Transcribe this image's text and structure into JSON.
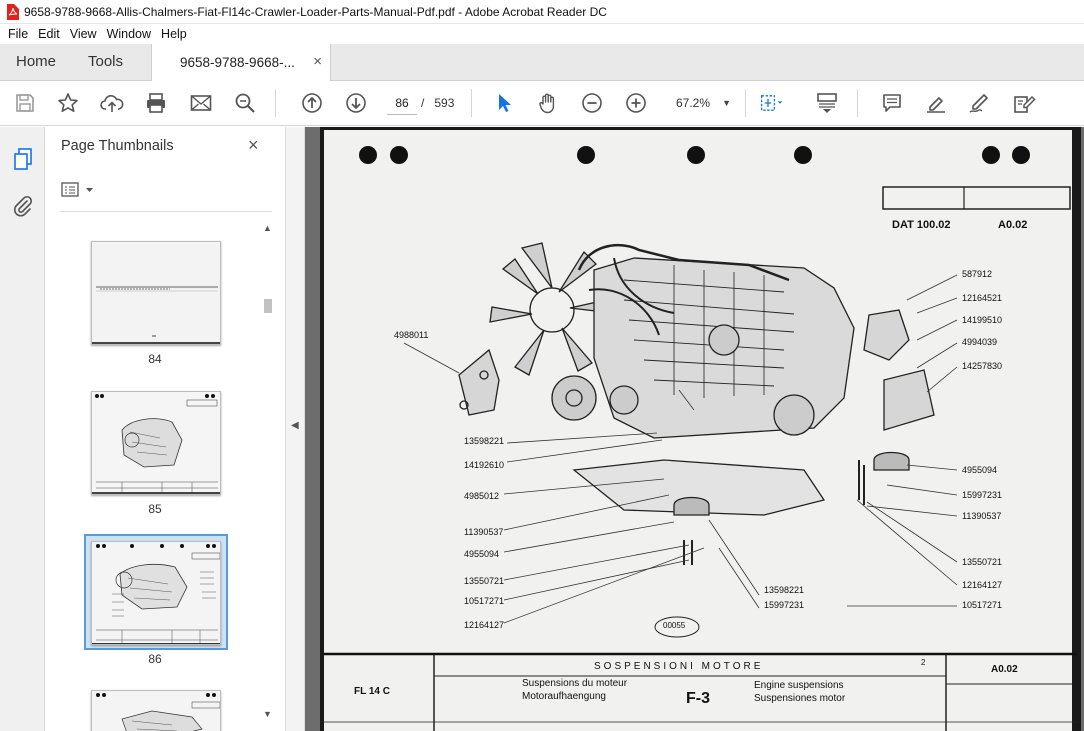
{
  "window": {
    "title": "9658-9788-9668-Allis-Chalmers-Fiat-Fl14c-Crawler-Loader-Parts-Manual-Pdf.pdf - Adobe Acrobat Reader DC"
  },
  "menu": [
    "File",
    "Edit",
    "View",
    "Window",
    "Help"
  ],
  "tabs": {
    "home": "Home",
    "tools": "Tools",
    "document": "9658-9788-9668-...",
    "close_symbol": "×"
  },
  "toolbar": {
    "current_page": "86",
    "page_separator": "/",
    "total_pages": "593",
    "zoom": "67.2%"
  },
  "thumbnails_panel": {
    "title": "Page Thumbnails",
    "close_symbol": "×",
    "pages": [
      {
        "label": "84"
      },
      {
        "label": "85"
      },
      {
        "label": "86",
        "selected": true
      }
    ]
  },
  "document_page": {
    "header_code_left": "DAT 100.02",
    "header_code_right": "A0.02",
    "part_numbers_left": [
      "4988011",
      "13598221",
      "14192610",
      "4985012",
      "11390537",
      "4955094",
      "13550721",
      "10517271",
      "12164127"
    ],
    "part_numbers_right": [
      "587912",
      "12164521",
      "14199510",
      "4994039",
      "14257830",
      "4955094",
      "15997231",
      "11390537",
      "13550721",
      "12164127",
      "10517271"
    ],
    "part_numbers_bottom": [
      "13598221",
      "15997231"
    ],
    "figure_ref": "00055",
    "footer": {
      "model": "FL 14 C",
      "title_it": "SOSPENSIONI MOTORE",
      "title_fr": "Suspensions du moteur",
      "title_de": "Motoraufhaengung",
      "title_en": "Engine suspensions",
      "title_es": "Suspensiones motor",
      "figure": "F-3",
      "sheet": "2",
      "code": "A0.02"
    }
  }
}
